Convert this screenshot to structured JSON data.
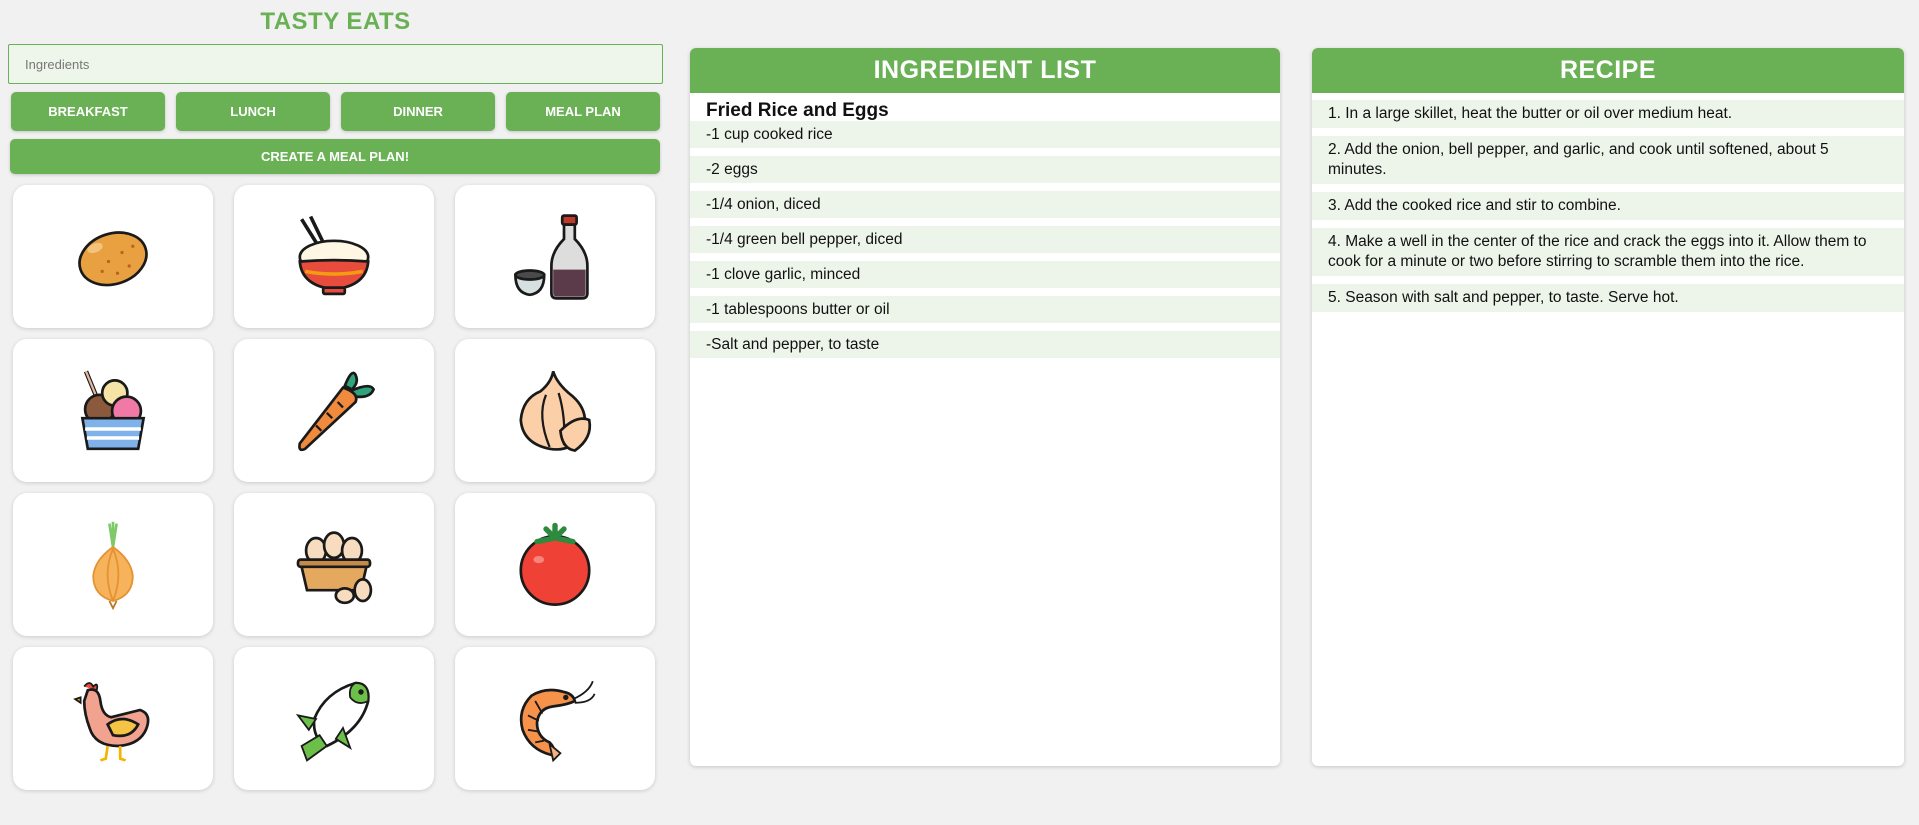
{
  "app": {
    "title": "TASTY EATS"
  },
  "search": {
    "placeholder": "Ingredients",
    "value": ""
  },
  "meal_buttons": [
    "BREAKFAST",
    "LUNCH",
    "DINNER",
    "MEAL PLAN"
  ],
  "create_button": "CREATE A MEAL PLAN!",
  "colors": {
    "accent": "#6ab055",
    "item_bg": "#edf5ea",
    "background": "#f1f1f1"
  },
  "ingredient_tiles": [
    {
      "icon": "potato-icon"
    },
    {
      "icon": "rice-bowl-icon"
    },
    {
      "icon": "soy-sauce-icon"
    },
    {
      "icon": "ice-cream-icon"
    },
    {
      "icon": "carrot-icon"
    },
    {
      "icon": "garlic-icon"
    },
    {
      "icon": "onion-icon"
    },
    {
      "icon": "eggs-basket-icon"
    },
    {
      "icon": "tomato-icon"
    },
    {
      "icon": "chicken-icon"
    },
    {
      "icon": "fish-icon"
    },
    {
      "icon": "shrimp-icon"
    }
  ],
  "ingredient_panel": {
    "title": "INGREDIENT LIST",
    "dish": "Fried Rice and Eggs",
    "items": [
      "-1 cup cooked rice",
      "-2 eggs",
      "-1/4 onion, diced",
      "-1/4 green bell pepper, diced",
      "-1 clove garlic, minced",
      "-1 tablespoons butter or oil",
      "-Salt and pepper, to taste"
    ]
  },
  "recipe_panel": {
    "title": "RECIPE",
    "steps": [
      "1. In a large skillet, heat the butter or oil over medium heat.",
      "2. Add the onion, bell pepper, and garlic, and cook until softened, about 5 minutes.",
      "3. Add the cooked rice and stir to combine.",
      "4. Make a well in the center of the rice and crack the eggs into it. Allow them to cook for a minute or two before stirring to scramble them into the rice.",
      "5. Season with salt and pepper, to taste. Serve hot."
    ]
  }
}
